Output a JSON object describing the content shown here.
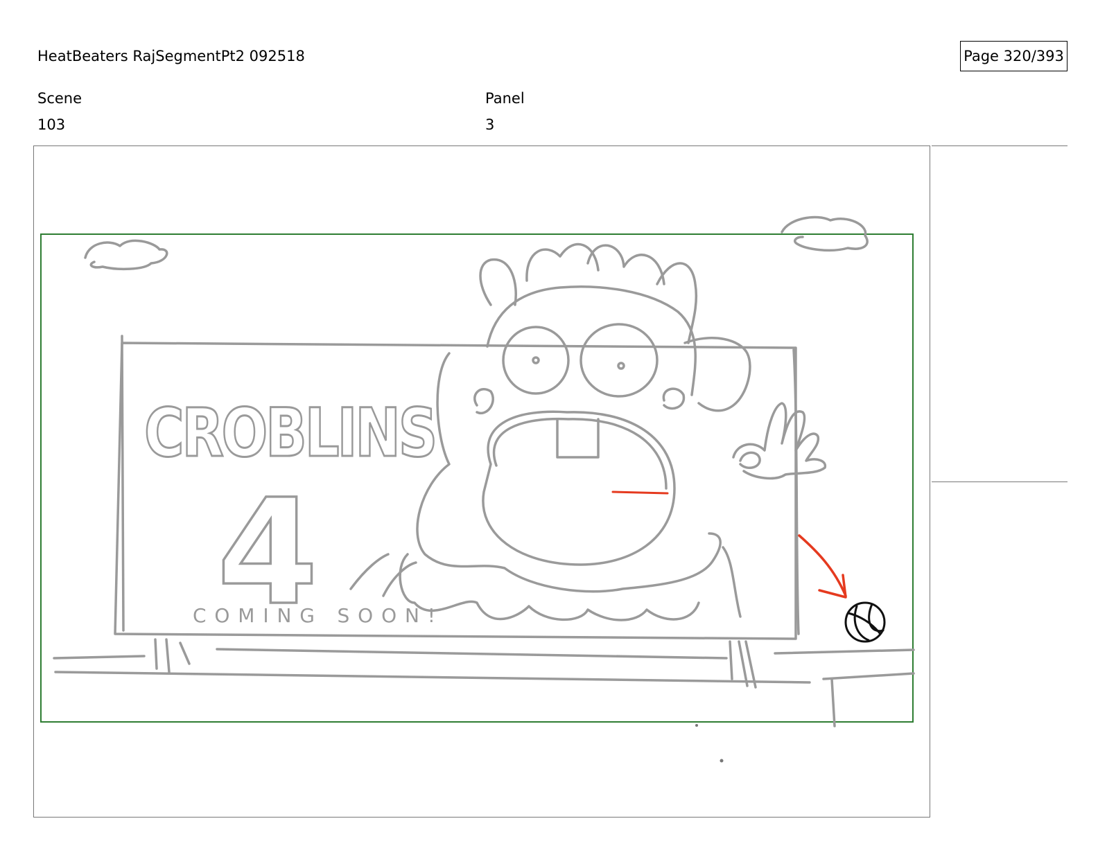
{
  "header": {
    "title": "HeatBeaters RajSegmentPt2 092518",
    "page": "Page 320/393"
  },
  "fields": {
    "scene_label": "Scene",
    "scene_value": "103",
    "panel_label": "Panel",
    "panel_value": "3"
  },
  "panel_art": {
    "billboard_title": "CROBLINS",
    "billboard_number": "4",
    "billboard_tagline": "COMING SOON!",
    "colors": {
      "sketch": "#9a9a9a",
      "safe_frame": "#2e7d32",
      "action_arrow": "#e53a1f",
      "ball": "#111111"
    }
  }
}
